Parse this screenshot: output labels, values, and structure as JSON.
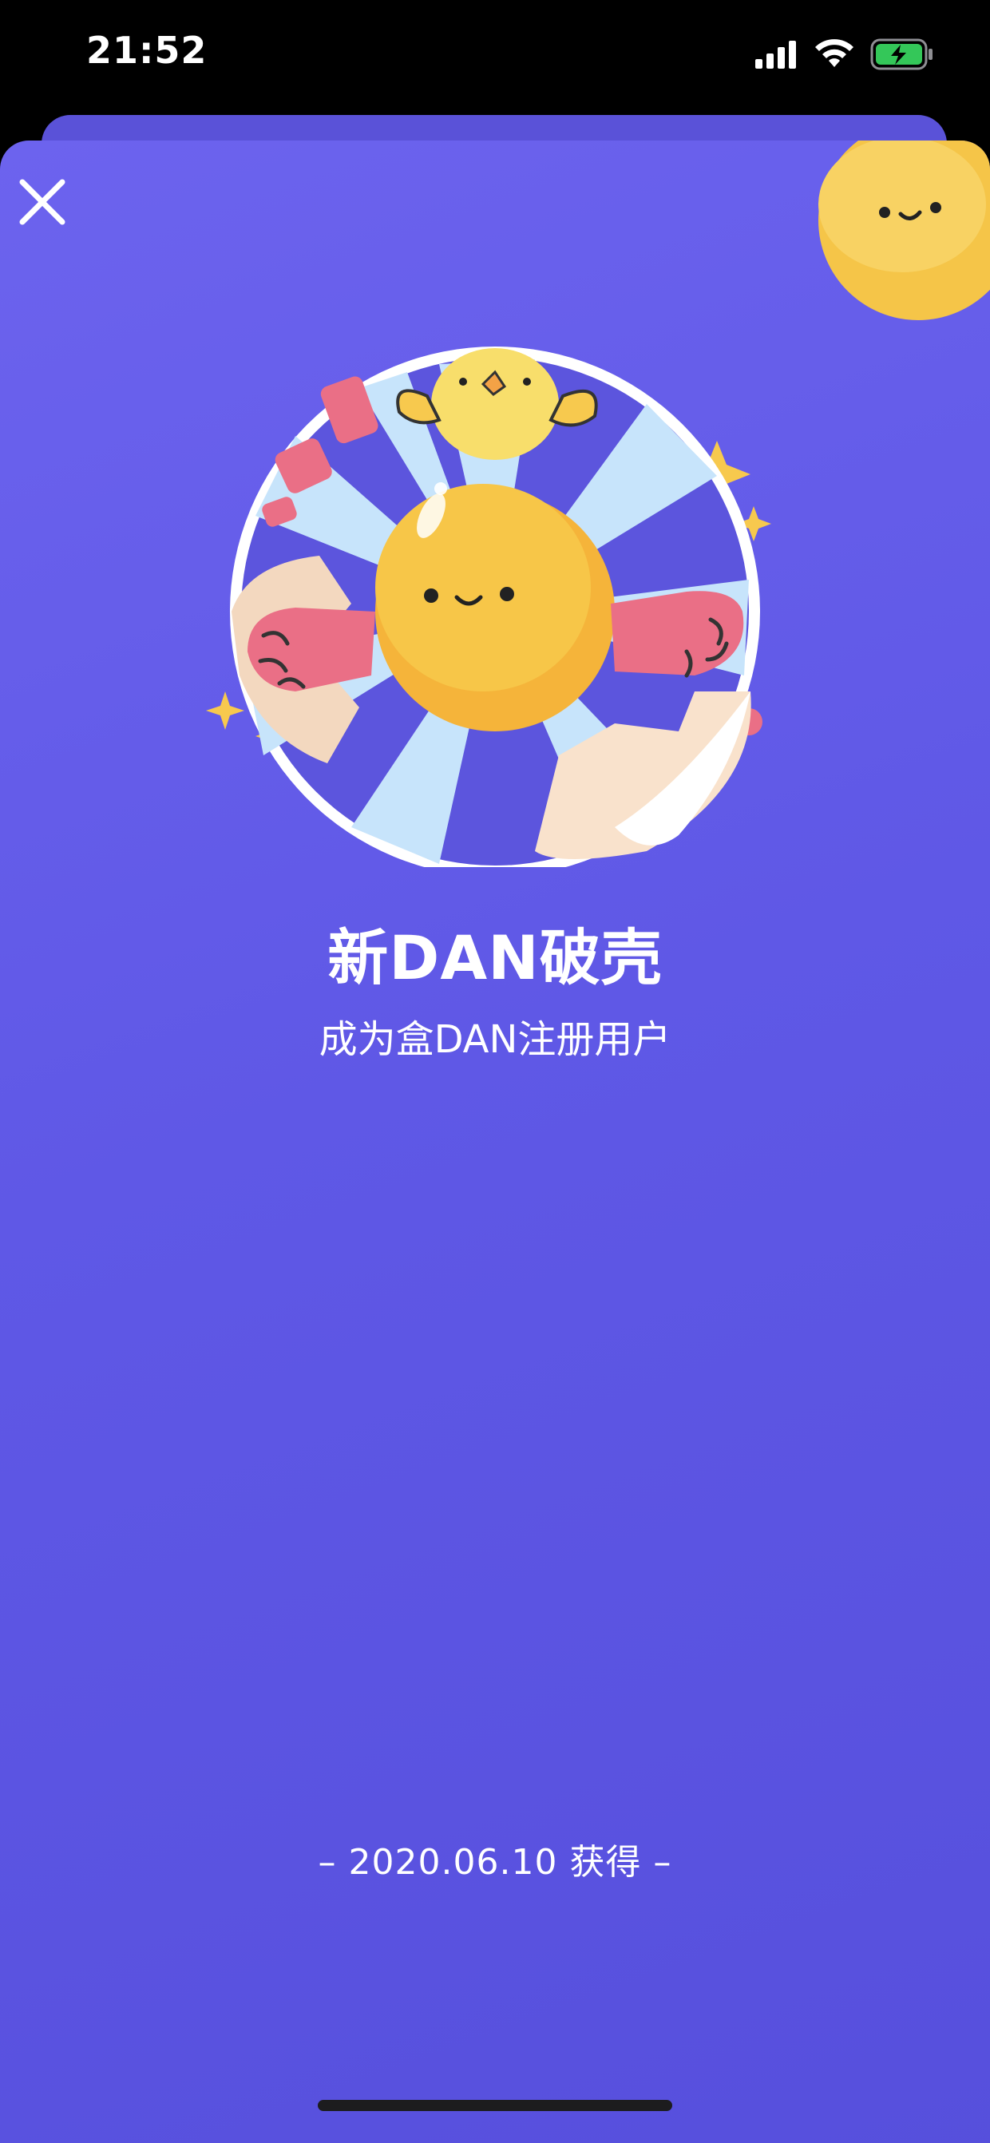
{
  "status_bar": {
    "time": "21:52",
    "icons": [
      "signal-icon",
      "wifi-icon",
      "battery-charging-icon"
    ]
  },
  "close_icon": "close-icon",
  "badge": {
    "title": "新DAN破壳",
    "subtitle": "成为盒DAN注册用户",
    "earned_date_text": "– 2020.06.10 获得 –"
  },
  "colors": {
    "background": "#6059e6",
    "accent_yellow": "#f7c94e",
    "accent_pink": "#ea6f86",
    "text": "#ffffff"
  }
}
